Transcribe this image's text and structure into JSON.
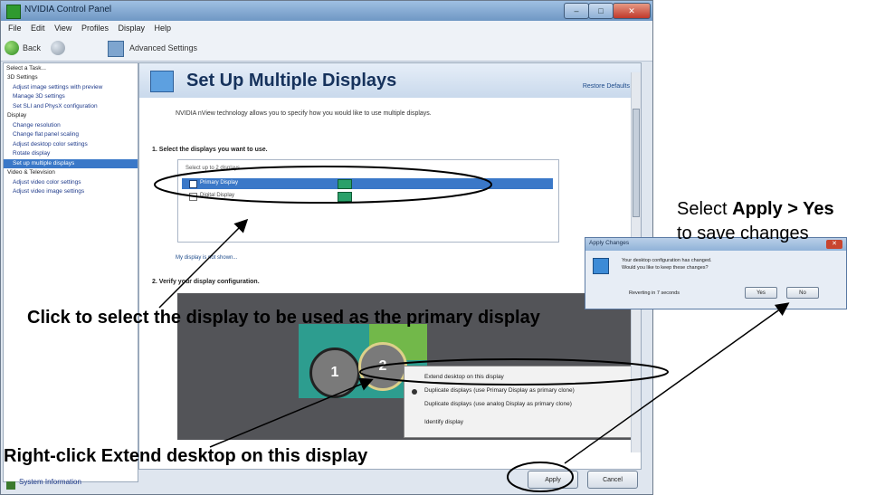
{
  "window": {
    "title": "NVIDIA Control Panel",
    "controls": {
      "minimize": "–",
      "maximize": "□",
      "close": "✕"
    }
  },
  "menu": [
    "File",
    "Edit",
    "View",
    "Profiles",
    "Display",
    "Help"
  ],
  "toolbar": {
    "back_label": "Back",
    "settings_label": "Advanced Settings"
  },
  "tree": {
    "header": "Select a Task...",
    "items": [
      {
        "label": "3D Settings",
        "kind": "category"
      },
      {
        "label": "Adjust image settings with preview",
        "kind": "item"
      },
      {
        "label": "Manage 3D settings",
        "kind": "item"
      },
      {
        "label": "Set SLI and PhysX configuration",
        "kind": "item"
      },
      {
        "label": "Display",
        "kind": "category"
      },
      {
        "label": "Change resolution",
        "kind": "item"
      },
      {
        "label": "Change flat panel scaling",
        "kind": "item"
      },
      {
        "label": "Adjust desktop color settings",
        "kind": "item"
      },
      {
        "label": "Rotate display",
        "kind": "item"
      },
      {
        "label": "Set up multiple displays",
        "kind": "selected"
      },
      {
        "label": "Video & Television",
        "kind": "category"
      },
      {
        "label": "Adjust video color settings",
        "kind": "item"
      },
      {
        "label": "Adjust video image settings",
        "kind": "item"
      }
    ],
    "system_info": "System Information"
  },
  "panel": {
    "title": "Set Up Multiple Displays",
    "restore": "Restore Defaults",
    "description": "NVIDIA nView technology allows you to specify how you would like to use multiple displays.",
    "section1": "1. Select the displays you want to use.",
    "list_header": "Select up to 2 displays.",
    "displays": [
      "Primary Display",
      "Digital Display"
    ],
    "link": "My display is not shown...",
    "section2": "2. Verify your display configuration."
  },
  "preview": {
    "num1": "1",
    "num2": "2"
  },
  "context_menu": [
    "Extend desktop on this display",
    "Duplicate displays (use Primary Display as primary clone)",
    "Duplicate displays (use analog Display as primary clone)",
    "Identify display"
  ],
  "buttons": {
    "apply": "Apply",
    "cancel": "Cancel"
  },
  "dialog": {
    "title": "Apply Changes",
    "line1": "Your desktop configuration has changed.",
    "line2": "Would you like to keep these changes?",
    "countdown": "Reverting in 7 seconds",
    "yes": "Yes",
    "no": "No",
    "close": "✕"
  },
  "annotations": {
    "apply_text_prefix": "Select ",
    "apply_text_bold": "Apply > Yes",
    "apply_text_line2": "to save changes",
    "primary_text": "Click to select the display to be used as the primary display",
    "rightclick_text": "Right-click Extend desktop on this display"
  }
}
